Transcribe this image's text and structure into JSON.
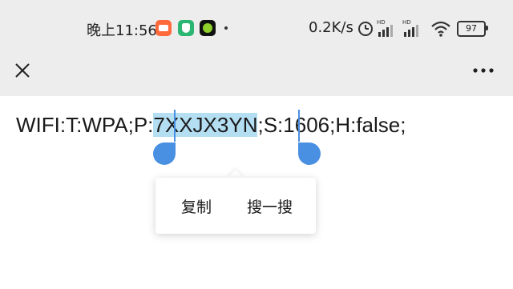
{
  "status_bar": {
    "time": "晚上11:56",
    "net_speed": "0.2K/s",
    "battery": "97",
    "icons": [
      "video-app-icon",
      "shield-app-icon",
      "green-dot-app-icon",
      "alarm-icon",
      "hd-signal-icon",
      "hd-signal-icon",
      "wifi-icon",
      "battery-icon"
    ]
  },
  "top_bar": {
    "close_icon": "close-icon",
    "more_icon": "more-icon"
  },
  "content": {
    "text_before": "WIFI:T:WPA;P:",
    "selected_text": "7XXJX3YN",
    "text_after": ";S:1606;H:false;"
  },
  "popup": {
    "copy_label": "复制",
    "search_label": "搜一搜"
  },
  "colors": {
    "selection": "#b4def2",
    "handle": "#4a90e2",
    "bar_bg": "#ededed"
  }
}
